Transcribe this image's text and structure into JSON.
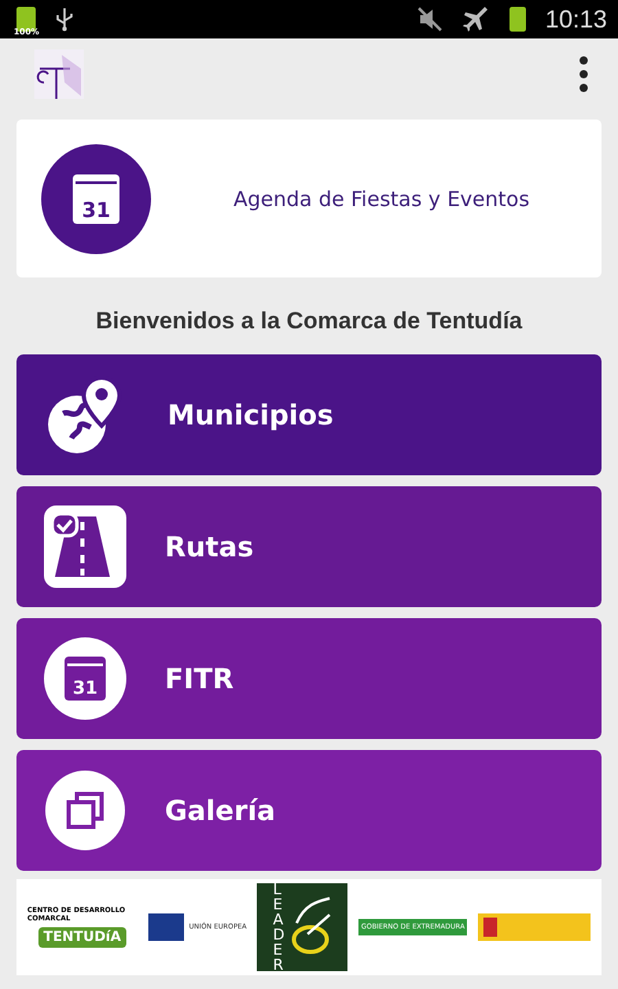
{
  "status_bar": {
    "battery_level": "100%",
    "time": "10:13"
  },
  "agenda_card": {
    "calendar_day": "31",
    "label": "Agenda de Fiestas y Eventos"
  },
  "heading": "Bienvenidos a la Comarca de Tentudía",
  "menu": [
    {
      "kind": "map",
      "label": "Municipios",
      "color": "#4b1488"
    },
    {
      "kind": "road",
      "label": "Rutas",
      "color": "#661a93"
    },
    {
      "kind": "calendar",
      "label": "FITR",
      "calendar_day": "31",
      "color": "#731c9c"
    },
    {
      "kind": "gallery",
      "label": "Galería",
      "color": "#7d20a5"
    }
  ],
  "footer_logos": {
    "tentudia_arc": "CENTRO DE DESARROLLO COMARCAL",
    "tentudia_name": "TENTUDíA",
    "eu": "UNIÓN EUROPEA",
    "leader": "LEADER",
    "extremadura": "GOBIERNO DE EXTREMADURA"
  }
}
